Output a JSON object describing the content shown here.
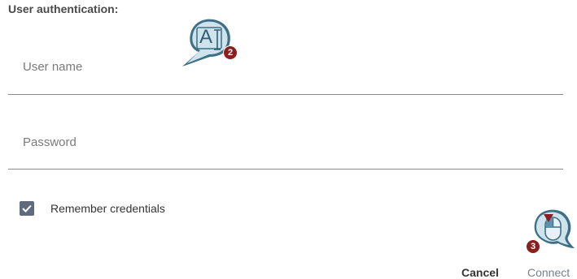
{
  "section_title": "User authentication:",
  "username": {
    "placeholder": "User name",
    "value": ""
  },
  "password": {
    "placeholder": "Password",
    "value": ""
  },
  "remember": {
    "label": "Remember credentials",
    "checked": true
  },
  "buttons": {
    "cancel": "Cancel",
    "connect": "Connect"
  },
  "callouts": [
    {
      "badge": "2",
      "icon": "text-cursor-icon",
      "glyph": "A"
    },
    {
      "badge": "3",
      "icon": "mouse-click-icon"
    }
  ],
  "colors": {
    "accent_badge": "#8b1e1e",
    "callout_fill": "#cfe3ec",
    "callout_stroke": "#3d6f86",
    "checkbox": "#5d6b7c"
  }
}
